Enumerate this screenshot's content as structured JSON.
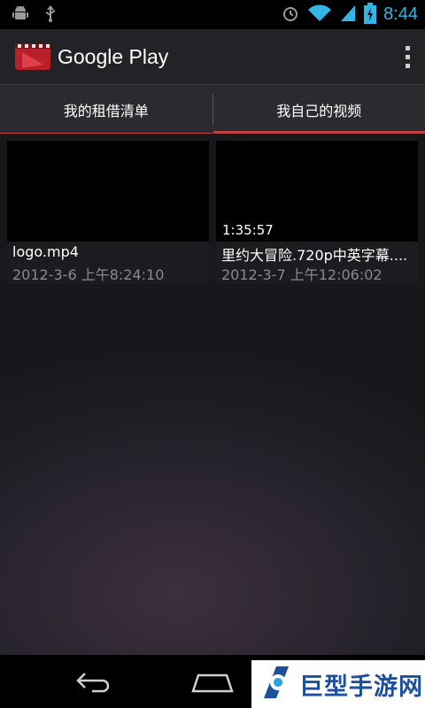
{
  "status_bar": {
    "time": "8:44",
    "left_icons": [
      "android-debug-icon",
      "usb-icon"
    ],
    "right_icons": [
      "alarm-icon",
      "wifi-icon",
      "signal-icon",
      "battery-charging-icon"
    ],
    "time_color": "#33b5e5"
  },
  "action_bar": {
    "title": "Google Play",
    "app_icon": "google-play-movies-icon",
    "overflow_icon": "overflow-menu-icon"
  },
  "tabs": [
    {
      "label": "我的租借清单",
      "selected": false
    },
    {
      "label": "我自己的视频",
      "selected": true
    }
  ],
  "videos": [
    {
      "duration": "",
      "title": "logo.mp4",
      "date": "2012-3-6 上午8:24:10"
    },
    {
      "duration": "1:35:57",
      "title": "里约大冒险.720p中英字幕....",
      "date": "2012-3-7 上午12:06:02"
    }
  ],
  "nav_bar": {
    "icons": [
      "back-icon",
      "home-icon"
    ]
  },
  "watermark": {
    "text": "巨型手游网"
  },
  "colors": {
    "accent": "#c2423f",
    "date_text": "#8a8a8e"
  }
}
